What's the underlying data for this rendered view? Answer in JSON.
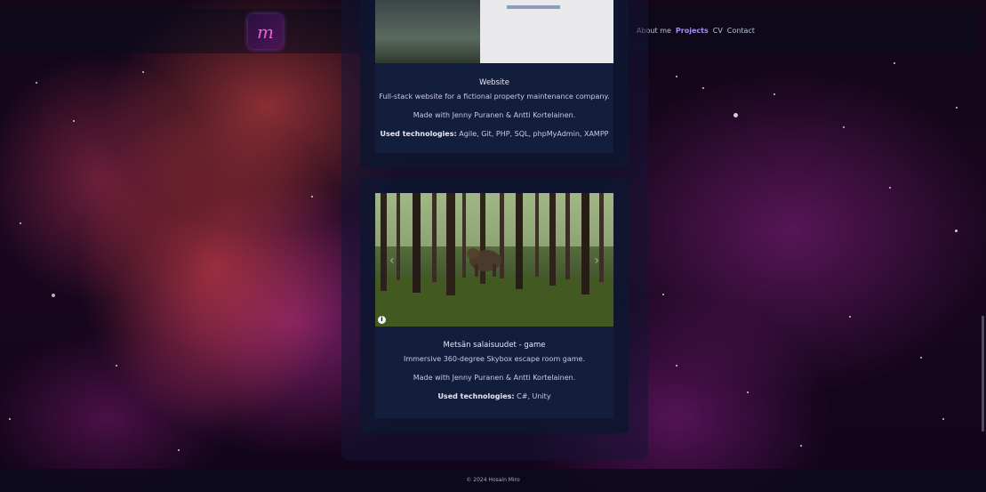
{
  "header": {
    "logo_letter": "m",
    "nav": [
      {
        "label": "About me",
        "active": false
      },
      {
        "label": "Projects",
        "active": true
      },
      {
        "label": "CV",
        "active": false
      },
      {
        "label": "Contact",
        "active": false
      }
    ]
  },
  "projects": [
    {
      "title": "Website",
      "description": "Full-stack website for a fictional property maintenance company.",
      "made_with": "Made with Jenny Puranen & Antti Kortelainen.",
      "tech_label": "Used technologies:",
      "tech_values": "Agile, Git, PHP, SQL, phpMyAdmin, XAMPP"
    },
    {
      "title": "Metsän salaisuudet - game",
      "description": "Immersive 360-degree Skybox escape room game.",
      "made_with": "Made with Jenny Puranen & Antti Kortelainen.",
      "tech_label": "Used technologies:",
      "tech_values": "C#, Unity",
      "carousel": {
        "prev": "‹",
        "next": "›",
        "info": "i"
      }
    }
  ],
  "footer": {
    "text": "© 2024 Hosain Miro"
  },
  "colors": {
    "accent": "#a98cff",
    "card": "#141e3e",
    "logo": "#e95fd4"
  }
}
